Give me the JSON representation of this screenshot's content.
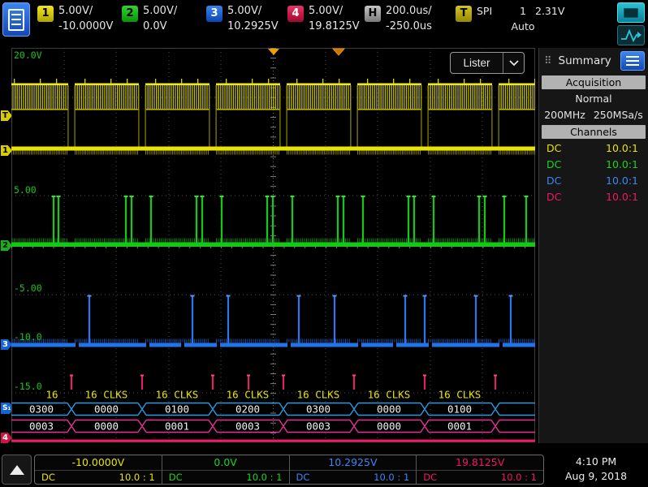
{
  "header": {
    "channels": [
      {
        "num": "1",
        "scale": "5.00V/",
        "offset": "-10.0000V"
      },
      {
        "num": "2",
        "scale": "5.00V/",
        "offset": "0.0V"
      },
      {
        "num": "3",
        "scale": "5.00V/",
        "offset": "10.2925V"
      },
      {
        "num": "4",
        "scale": "5.00V/",
        "offset": "19.8125V"
      }
    ],
    "horizontal": {
      "label": "H",
      "scale": "200.0us/",
      "delay": "-250.0us"
    },
    "trigger": {
      "label": "T",
      "type": "SPI",
      "source": "1",
      "level": "2.31V",
      "mode": "Auto"
    }
  },
  "graticule": {
    "lister_button": {
      "label": "Lister"
    },
    "scale_labels": {
      "top": "20.0V",
      "p5": "5.00",
      "m5": "-5.00",
      "m10": "-10.0",
      "m15": "-15.0"
    },
    "markers": {
      "trigger": "T",
      "ch1": "1",
      "ch2": "2",
      "ch3": "3",
      "ch4": "4",
      "serial": "S₁"
    },
    "clock_labels": [
      "16",
      "16 CLKS",
      "16 CLKS",
      "16 CLKS",
      "16 CLKS",
      "16 CLKS",
      "16 CLKS"
    ],
    "mosi_bus": [
      "0300",
      "0000",
      "0100",
      "0200",
      "0300",
      "0000",
      "0100"
    ],
    "miso_bus": [
      "0003",
      "0000",
      "0001",
      "0003",
      "0003",
      "0000",
      "0001"
    ]
  },
  "sidebar": {
    "title": "Summary",
    "acquisition": {
      "header": "Acquisition",
      "mode": "Normal",
      "bandwidth": "200MHz",
      "sample_rate": "250MSa/s"
    },
    "channels": {
      "header": "Channels",
      "rows": [
        {
          "coupling": "DC",
          "probe": "10.0:1"
        },
        {
          "coupling": "DC",
          "probe": "10.0:1"
        },
        {
          "coupling": "DC",
          "probe": "10.0:1"
        },
        {
          "coupling": "DC",
          "probe": "10.0:1"
        }
      ]
    }
  },
  "footer": {
    "measurements": [
      {
        "value": "-10.0000V",
        "coupling": "DC",
        "probe": "10.0 : 1"
      },
      {
        "value": "0.0V",
        "coupling": "DC",
        "probe": "10.0 : 1"
      },
      {
        "value": "10.2925V",
        "coupling": "DC",
        "probe": "10.0 : 1"
      },
      {
        "value": "19.8125V",
        "coupling": "DC",
        "probe": "10.0 : 1"
      }
    ],
    "clock": {
      "time": "4:10 PM",
      "date": "Aug 9, 2018"
    }
  },
  "colors": {
    "ch1": "#e8e400",
    "ch2": "#1ad41a",
    "ch3": "#3a86f6",
    "ch4": "#f01866",
    "accent_teal": "#2cc0d4",
    "menu_blue": "#2a6ae0",
    "marker_orange": "#f09000"
  }
}
